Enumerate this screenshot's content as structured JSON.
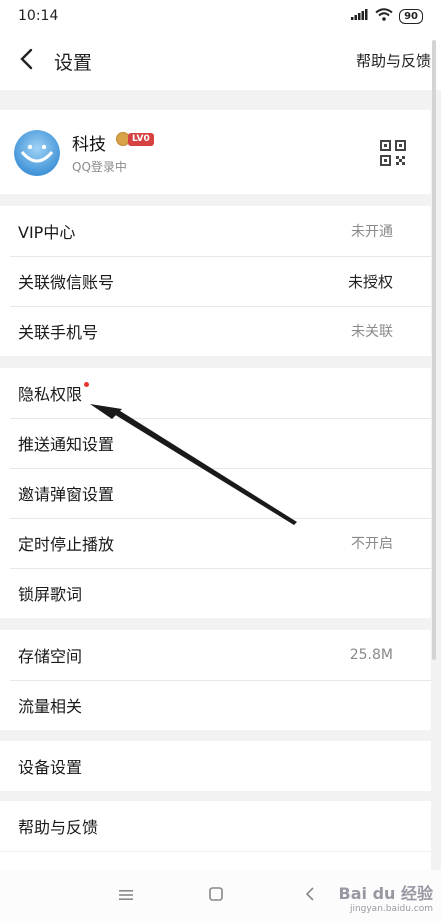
{
  "status_bar": {
    "time": "10:14",
    "battery": "90",
    "icons": [
      "signal-icon",
      "wifi-icon",
      "battery-icon"
    ]
  },
  "header": {
    "title": "设置",
    "help": "帮助与反馈"
  },
  "profile": {
    "name": "科技",
    "level": "LV0",
    "login_status": "QQ登录中"
  },
  "groups": [
    {
      "rows": [
        {
          "label": "VIP中心",
          "value": "未开通",
          "emphasis": false
        },
        {
          "label": "关联微信账号",
          "value": "未授权",
          "emphasis": true
        },
        {
          "label": "关联手机号",
          "value": "未关联",
          "emphasis": false
        }
      ]
    },
    {
      "rows": [
        {
          "label": "隐私权限",
          "value": "",
          "dot": true
        },
        {
          "label": "推送通知设置",
          "value": ""
        },
        {
          "label": "邀请弹窗设置",
          "value": ""
        },
        {
          "label": "定时停止播放",
          "value": "不开启"
        },
        {
          "label": "锁屏歌词",
          "value": ""
        }
      ]
    },
    {
      "rows": [
        {
          "label": "存储空间",
          "value": "25.8M"
        },
        {
          "label": "流量相关",
          "value": ""
        }
      ]
    },
    {
      "rows": [
        {
          "label": "设备设置",
          "value": ""
        }
      ]
    },
    {
      "rows": [
        {
          "label": "帮助与反馈",
          "value": ""
        }
      ]
    }
  ],
  "watermark": {
    "text": "Bai du 经验",
    "url": "jingyan.baidu.com"
  },
  "colors": {
    "page_bg": "#f2f2f2",
    "card_bg": "#ffffff",
    "red_dot": "#e9342f",
    "level_badge": "#d84141",
    "secondary_text": "#8a8a8a"
  }
}
